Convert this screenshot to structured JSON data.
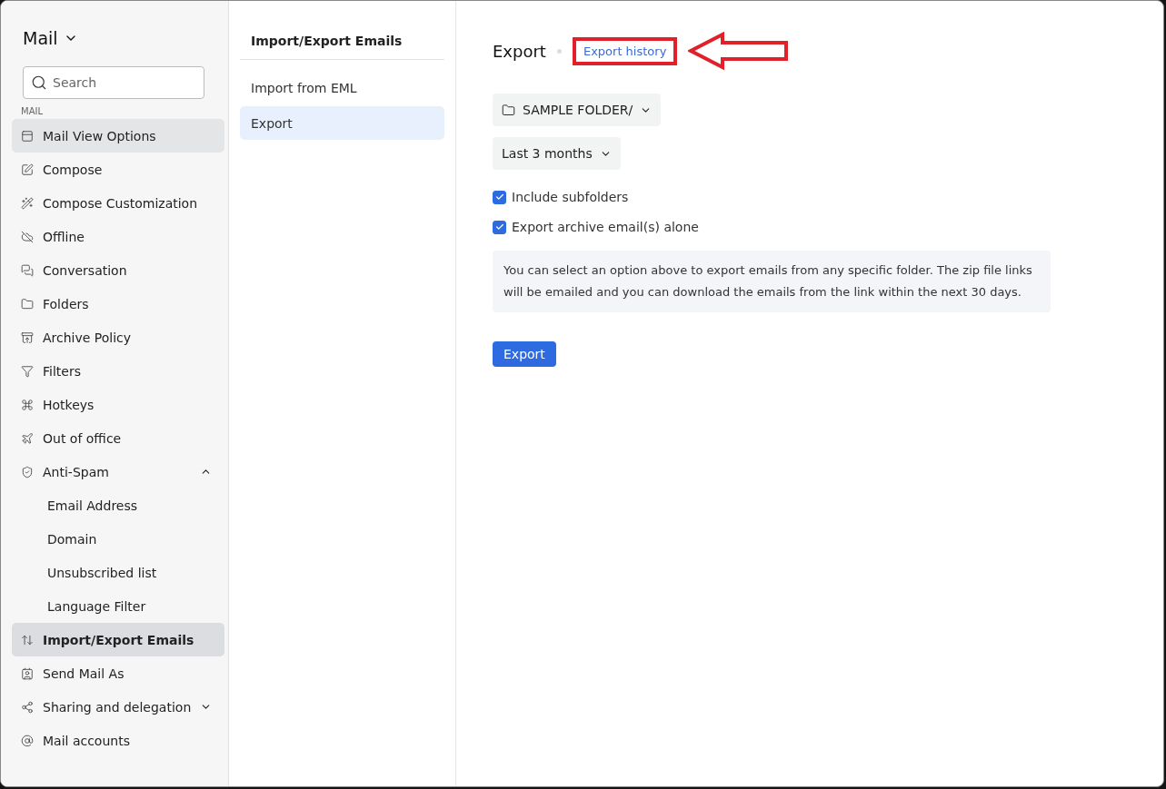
{
  "app_switcher": {
    "label": "Mail"
  },
  "search": {
    "placeholder": "Search"
  },
  "sidebar": {
    "section": "MAIL",
    "items": [
      {
        "label": "Mail View Options",
        "selected": false,
        "hovered": true
      },
      {
        "label": "Compose",
        "selected": false,
        "hovered": false
      },
      {
        "label": "Compose Customization",
        "selected": false,
        "hovered": false
      },
      {
        "label": "Offline",
        "selected": false,
        "hovered": false
      },
      {
        "label": "Conversation",
        "selected": false,
        "hovered": false
      },
      {
        "label": "Folders",
        "selected": false,
        "hovered": false
      },
      {
        "label": "Archive Policy",
        "selected": false,
        "hovered": false
      },
      {
        "label": "Filters",
        "selected": false,
        "hovered": false
      },
      {
        "label": "Hotkeys",
        "selected": false,
        "hovered": false
      },
      {
        "label": "Out of office",
        "selected": false,
        "hovered": false
      },
      {
        "label": "Anti-Spam",
        "selected": false,
        "hovered": false,
        "expanded": true,
        "children": [
          {
            "label": "Email Address",
            "selected": false
          },
          {
            "label": "Domain",
            "selected": false
          },
          {
            "label": "Unsubscribed list",
            "selected": false
          },
          {
            "label": "Language Filter",
            "selected": false
          }
        ]
      },
      {
        "label": "Import/Export Emails",
        "selected": true,
        "hovered": false
      },
      {
        "label": "Send Mail As",
        "selected": false,
        "hovered": false
      },
      {
        "label": "Sharing and delegation",
        "selected": false,
        "hovered": false,
        "expanded": false
      },
      {
        "label": "Mail accounts",
        "selected": false,
        "hovered": false
      }
    ]
  },
  "subnav": {
    "title": "Import/Export Emails",
    "items": [
      {
        "label": "Import from EML",
        "selected": false
      },
      {
        "label": "Export",
        "selected": true
      }
    ]
  },
  "content": {
    "title": "Export",
    "history_link": {
      "label": "Export history",
      "highlighted": true
    },
    "folder_select": "SAMPLE FOLDER/",
    "period_select": "Last 3 months",
    "options": [
      {
        "label": "Include subfolders",
        "checked": true
      },
      {
        "label": "Export archive email(s) alone",
        "checked": true
      }
    ],
    "info": "You can select an option above to export emails from any specific folder. The zip file links will be emailed and you can download the emails from the link within the next 30 days.",
    "button": "Export"
  }
}
